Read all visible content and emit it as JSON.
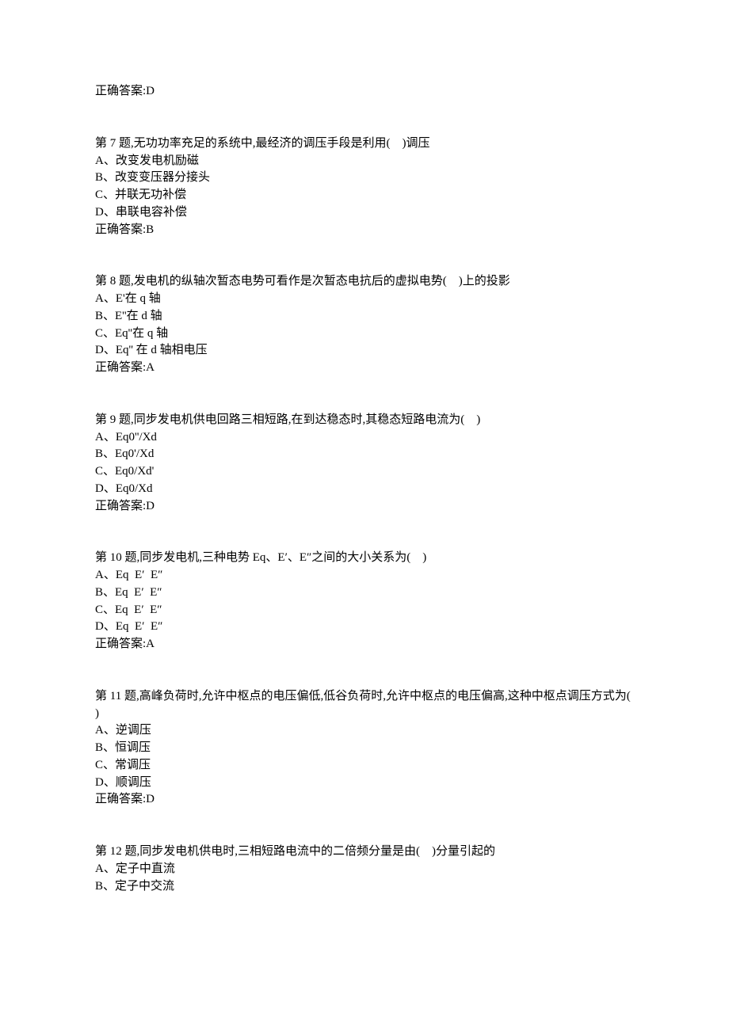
{
  "top_answer": "正确答案:D",
  "questions": [
    {
      "stem": "第 7 题,无功功率充足的系统中,最经济的调压手段是利用(    )调压",
      "options": [
        "A、改变发电机励磁",
        "B、改变变压器分接头",
        "C、并联无功补偿",
        "D、串联电容补偿"
      ],
      "answer": "正确答案:B"
    },
    {
      "stem": "第 8 题,发电机的纵轴次暂态电势可看作是次暂态电抗后的虚拟电势(    )上的投影",
      "options": [
        "A、E'在 q 轴",
        "B、E''在 d 轴",
        "C、Eq''在 q 轴",
        "D、Eq'' 在 d 轴相电压"
      ],
      "answer": "正确答案:A"
    },
    {
      "stem": "第 9 题,同步发电机供电回路三相短路,在到达稳态时,其稳态短路电流为(    )",
      "options": [
        "A、Eq0''/Xd",
        "B、Eq0'/Xd",
        "C、Eq0/Xd'",
        "D、Eq0/Xd"
      ],
      "answer": "正确答案:D"
    },
    {
      "stem": "第 10 题,同步发电机,三种电势 Eq、E′、E″之间的大小关系为(    )",
      "options": [
        "A、Eq  E′  E″",
        "B、Eq  E′  E″",
        "C、Eq  E′  E″",
        "D、Eq  E′  E″"
      ],
      "answer": "正确答案:A"
    },
    {
      "stem": "第 11 题,高峰负荷时,允许中枢点的电压偏低,低谷负荷时,允许中枢点的电压偏高,这种中枢点调压方式为(    )",
      "options": [
        "A、逆调压",
        "B、恒调压",
        "C、常调压",
        "D、顺调压"
      ],
      "answer": "正确答案:D"
    },
    {
      "stem": "第 12 题,同步发电机供电时,三相短路电流中的二倍频分量是由(    )分量引起的",
      "options": [
        "A、定子中直流",
        "B、定子中交流"
      ],
      "answer": ""
    }
  ]
}
